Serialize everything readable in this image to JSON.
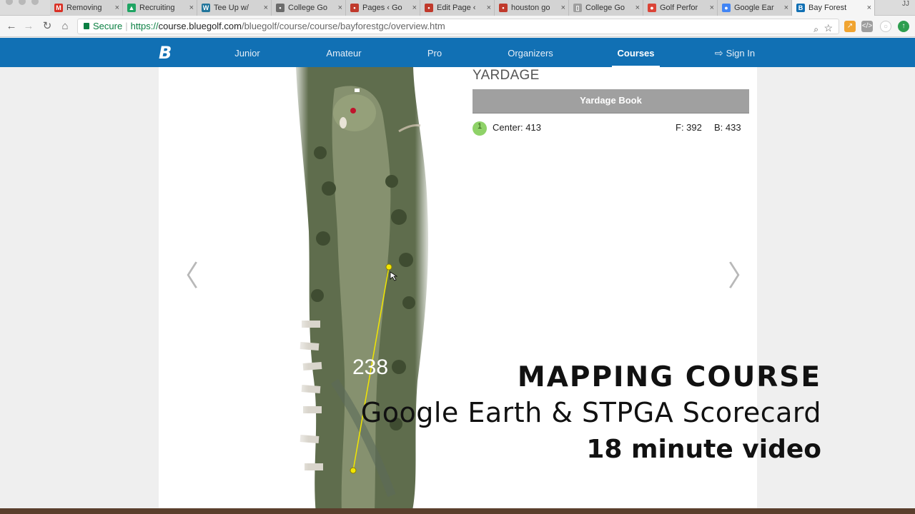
{
  "browser": {
    "tabs": [
      {
        "label": "Removing",
        "favicon": "gmail-icon",
        "color": "#d93025",
        "glyph": "M"
      },
      {
        "label": "Recruiting",
        "favicon": "drive-icon",
        "color": "#1fa463",
        "glyph": "▲"
      },
      {
        "label": "Tee Up w/",
        "favicon": "wordpress-icon",
        "color": "#21759b",
        "glyph": "W"
      },
      {
        "label": "College Go",
        "favicon": "site-icon",
        "color": "#6b6b6b",
        "glyph": "•"
      },
      {
        "label": "Pages ‹ Go",
        "favicon": "page-icon",
        "color": "#c0392b",
        "glyph": "•"
      },
      {
        "label": "Edit Page ‹",
        "favicon": "page-icon",
        "color": "#c0392b",
        "glyph": "•"
      },
      {
        "label": "houston go",
        "favicon": "page-icon",
        "color": "#c0392b",
        "glyph": "•"
      },
      {
        "label": "College Go",
        "favicon": "doc-icon",
        "color": "#9e9e9e",
        "glyph": "▯"
      },
      {
        "label": "Golf Perfor",
        "favicon": "chrome-icon",
        "color": "#db4437",
        "glyph": "●"
      },
      {
        "label": "Google Ear",
        "favicon": "earth-icon",
        "color": "#4285f4",
        "glyph": "●"
      },
      {
        "label": "Bay Forest",
        "favicon": "bluegolf-icon",
        "color": "#1170b4",
        "glyph": "B",
        "active": true
      }
    ],
    "close_glyph": "×",
    "profile": "JJ",
    "address": {
      "secure_label": "Secure",
      "scheme": "https://",
      "host": "course.bluegolf.com",
      "path": "/bluegolf/course/course/bayforestgc/overview.htm"
    }
  },
  "site": {
    "logo": "B",
    "nav": [
      {
        "label": "Junior"
      },
      {
        "label": "Amateur"
      },
      {
        "label": "Pro"
      },
      {
        "label": "Organizers"
      },
      {
        "label": "Courses",
        "active": true
      },
      {
        "label": "Sign In",
        "icon": "sign-in-icon"
      }
    ]
  },
  "yardage": {
    "heading": "YARDAGE",
    "book_button": "Yardage Book",
    "hole": "1",
    "center": "Center: 413",
    "front": "F: 392",
    "back": "B: 433"
  },
  "map": {
    "distance_label": "238",
    "line_color": "#f2e600"
  },
  "carousel": {
    "prev_glyph": "〈",
    "next_glyph": "〉"
  },
  "overlay": {
    "line1": "MAPPING COURSE",
    "line2": "Google Earth &  STPGA  Scorecard",
    "line3": "18 minute video"
  }
}
